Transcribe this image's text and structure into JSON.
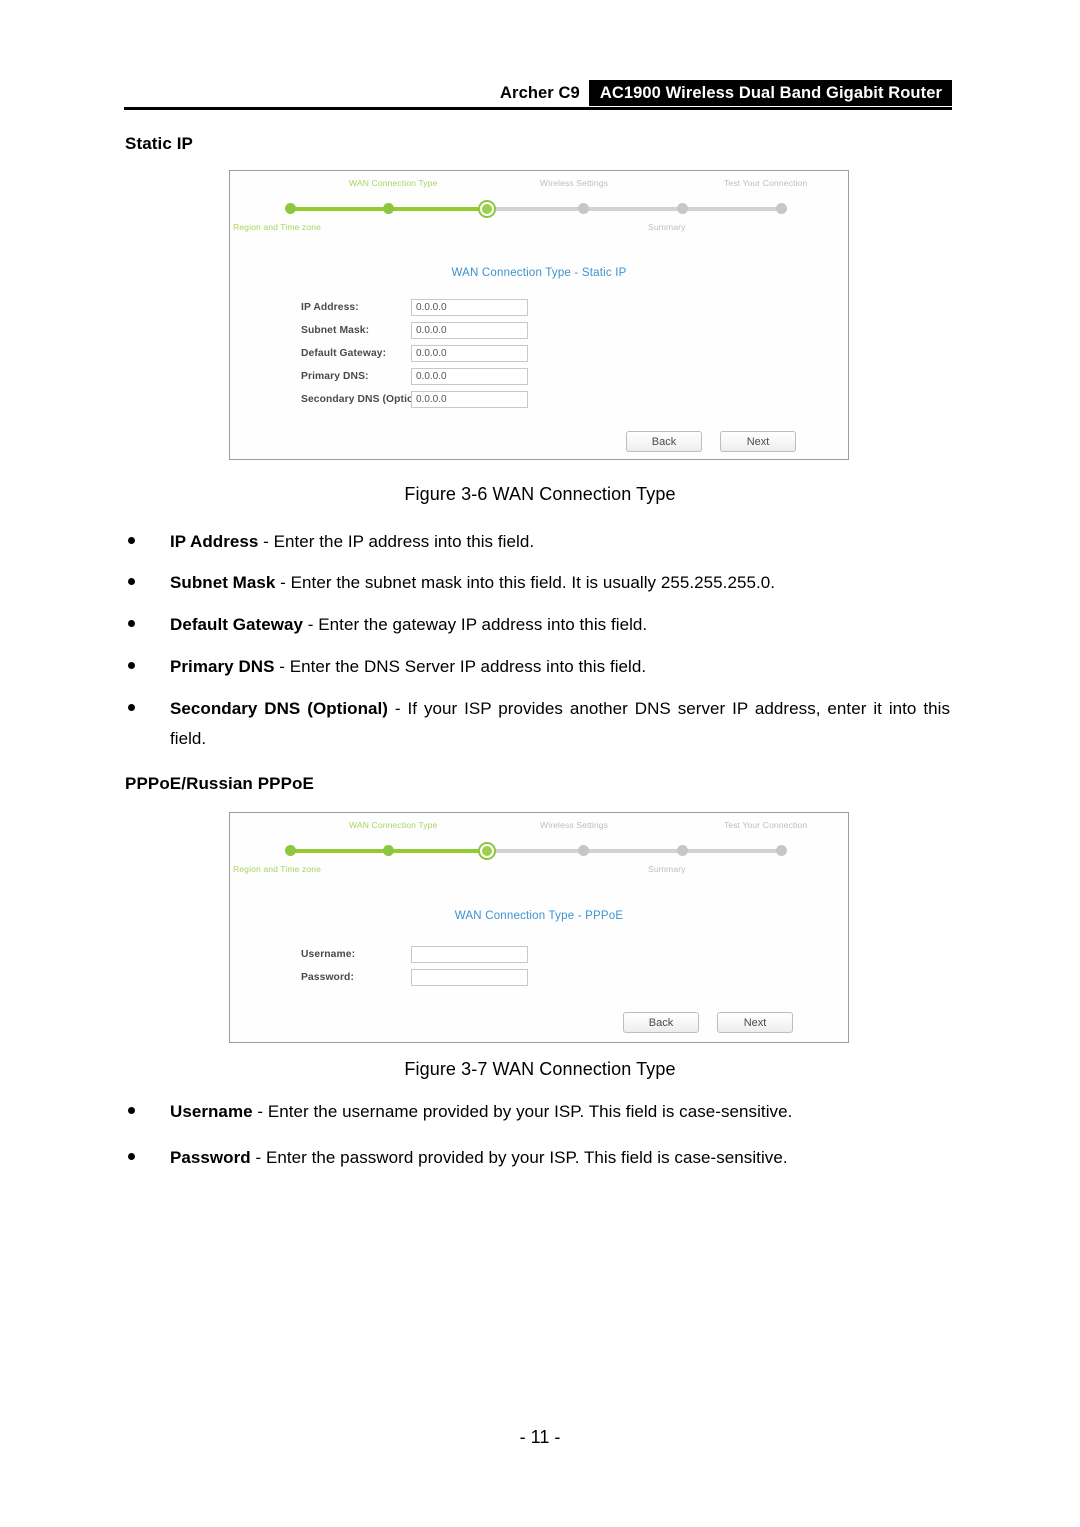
{
  "header": {
    "model": "Archer C9",
    "product": "AC1900 Wireless Dual Band Gigabit Router"
  },
  "sections": {
    "static_ip_title": "Static IP",
    "pppoe_title": "PPPoE/Russian PPPoE"
  },
  "colors": {
    "stepper_done": "#8ec63f",
    "stepper_track": "#d2d2d2",
    "stepper_label_green": "#a8d45f",
    "stepper_label_gray": "#bdbdbd",
    "panel_heading": "#3b93cf",
    "header_bar": "#000000"
  },
  "stepper": {
    "labels_top": [
      "WAN Connection Type",
      "Wireless Settings",
      "Test Your Connection"
    ],
    "labels_bottom": [
      "Region and Time zone",
      "Summary"
    ],
    "nodes": [
      {
        "state": "done"
      },
      {
        "state": "done"
      },
      {
        "state": "active"
      },
      {
        "state": "pending"
      },
      {
        "state": "pending"
      },
      {
        "state": "pending"
      }
    ]
  },
  "figure_static": {
    "heading": "WAN Connection Type - Static IP",
    "fields": [
      {
        "label": "IP Address:",
        "value": "0.0.0.0"
      },
      {
        "label": "Subnet Mask:",
        "value": "0.0.0.0"
      },
      {
        "label": "Default Gateway:",
        "value": "0.0.0.0"
      },
      {
        "label": "Primary DNS:",
        "value": "0.0.0.0"
      },
      {
        "label": "Secondary DNS (Optional):",
        "value": "0.0.0.0"
      }
    ],
    "buttons": {
      "back": "Back",
      "next": "Next"
    },
    "caption": "Figure 3-6 WAN Connection Type"
  },
  "figure_pppoe": {
    "heading": "WAN Connection Type - PPPoE",
    "fields": [
      {
        "label": "Username:",
        "value": ""
      },
      {
        "label": "Password:",
        "value": ""
      }
    ],
    "buttons": {
      "back": "Back",
      "next": "Next"
    },
    "caption": "Figure 3-7 WAN Connection Type"
  },
  "bullets": {
    "ip_address": {
      "term": "IP Address",
      "desc": " - Enter the IP address into this field."
    },
    "subnet_mask": {
      "term": "Subnet Mask",
      "desc": " - Enter the subnet mask into this field. It is usually 255.255.255.0."
    },
    "default_gateway": {
      "term": "Default Gateway",
      "desc": " - Enter the gateway IP address into this field."
    },
    "primary_dns": {
      "term": "Primary DNS",
      "desc": " - Enter the DNS Server IP address into this field."
    },
    "secondary_dns": {
      "term": "Secondary DNS (Optional)",
      "desc": " - If your ISP provides another DNS server IP address, enter it into this field."
    },
    "username": {
      "term": "Username",
      "desc": " - Enter the username provided by your ISP. This field is case-sensitive."
    },
    "password": {
      "term": "Password",
      "desc": " - Enter the password provided by your ISP. This field is case-sensitive."
    }
  },
  "footer": {
    "page_number": "- 11 -"
  }
}
